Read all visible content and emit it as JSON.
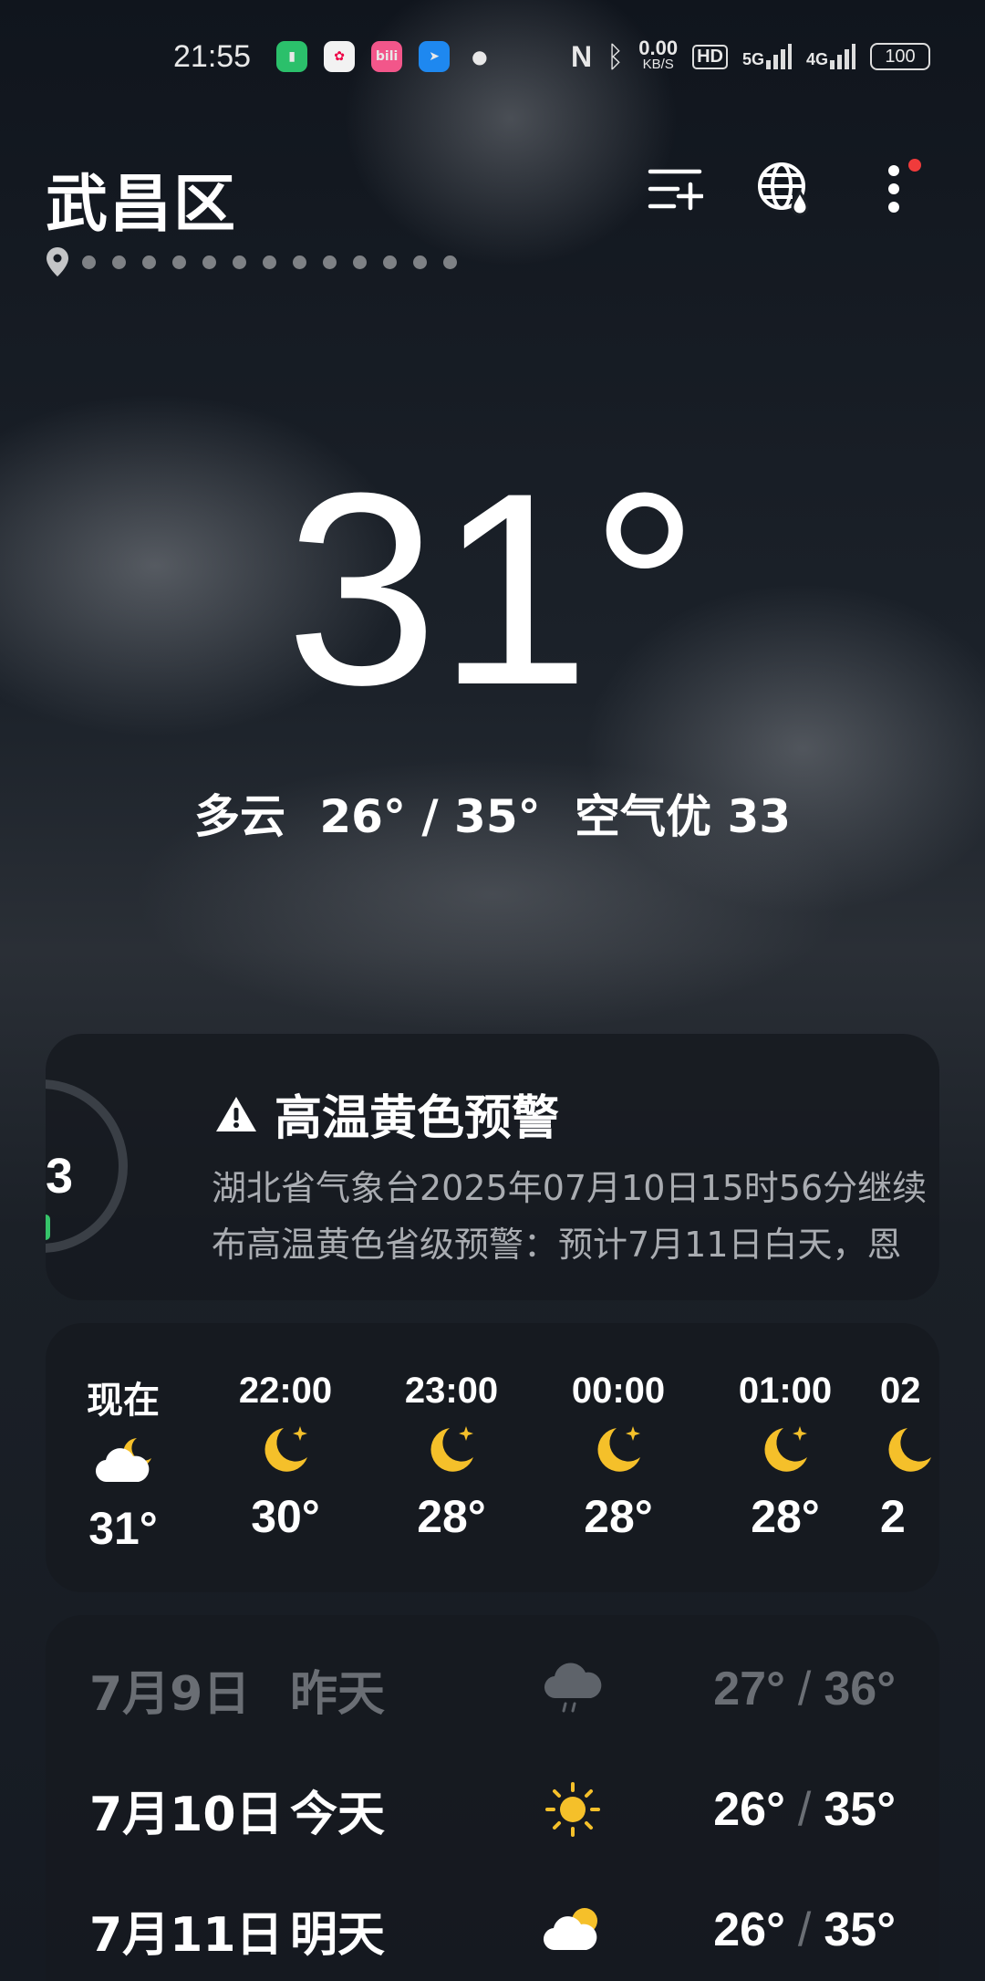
{
  "status_bar": {
    "time": "21:55",
    "network_speed": "0.00",
    "network_unit": "KB/S",
    "hd": "HD",
    "signal1": "5G",
    "signal2": "4G",
    "battery": "100"
  },
  "header": {
    "city": "武昌区",
    "icons": [
      "add-city-icon",
      "globe-rain-icon",
      "more-icon"
    ]
  },
  "current": {
    "temperature": "31°",
    "condition": "多云",
    "range": "26° / 35°",
    "air_quality": "空气优 33"
  },
  "alert": {
    "ring_value": "3",
    "title": "高温黄色预警",
    "line1": "湖北省气象台2025年07月10日15时56分继续",
    "line2": "布高温黄色省级预警：预计7月11日白天，恩",
    "colors": {
      "ring_accent": "#36c46a"
    }
  },
  "hourly": [
    {
      "label": "现在",
      "icon": "cloudy-night-icon",
      "temp": "31°"
    },
    {
      "label": "22:00",
      "icon": "moon-icon",
      "temp": "30°"
    },
    {
      "label": "23:00",
      "icon": "moon-icon",
      "temp": "28°"
    },
    {
      "label": "00:00",
      "icon": "moon-icon",
      "temp": "28°"
    },
    {
      "label": "01:00",
      "icon": "moon-icon",
      "temp": "28°"
    },
    {
      "label": "02",
      "icon": "moon-icon",
      "temp": "2"
    }
  ],
  "daily": [
    {
      "date": "7月9日",
      "name": "昨天",
      "icon": "rain-icon",
      "low": "27°",
      "high": "36°"
    },
    {
      "date": "7月10日",
      "name": "今天",
      "icon": "sun-icon",
      "low": "26°",
      "high": "35°"
    },
    {
      "date": "7月11日",
      "name": "明天",
      "icon": "partly-cloudy-icon",
      "low": "26°",
      "high": "35°"
    }
  ],
  "colors": {
    "moon": "#f5c02a",
    "sun": "#f5c02a"
  }
}
